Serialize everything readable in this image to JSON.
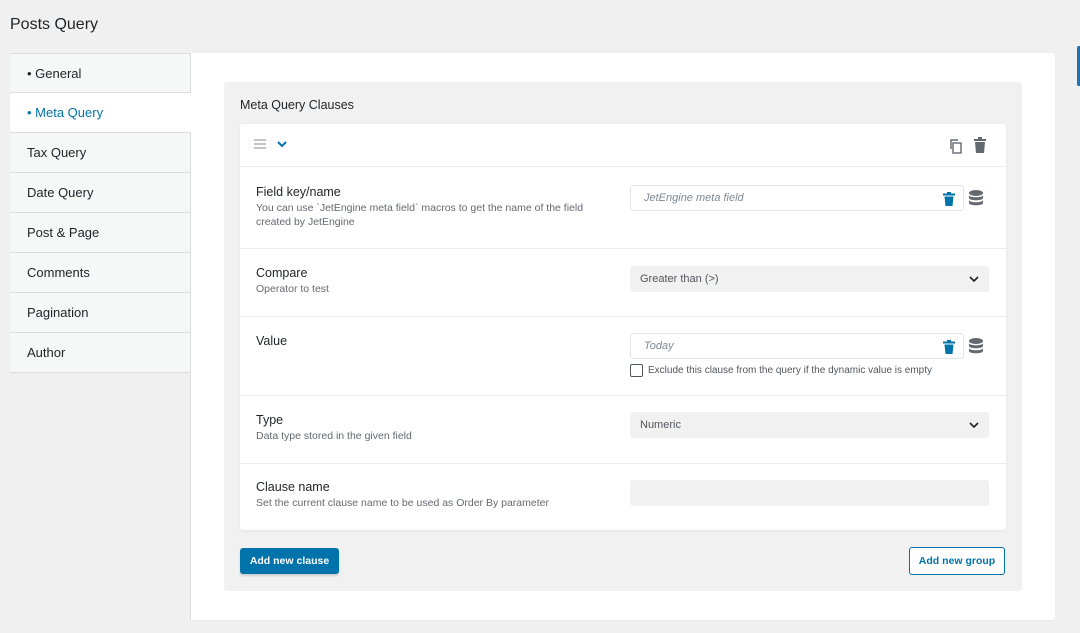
{
  "page": {
    "title": "Posts Query"
  },
  "sidebar": {
    "items": [
      {
        "label": "• General",
        "active": false
      },
      {
        "label": "• Meta Query",
        "active": true
      },
      {
        "label": "Tax Query",
        "active": false
      },
      {
        "label": "Date Query",
        "active": false
      },
      {
        "label": "Post & Page",
        "active": false
      },
      {
        "label": "Comments",
        "active": false
      },
      {
        "label": "Pagination",
        "active": false
      },
      {
        "label": "Author",
        "active": false
      }
    ]
  },
  "meta_query": {
    "section_title": "Meta Query Clauses",
    "clause": {
      "field_key": {
        "label": "Field key/name",
        "description": "You can use `JetEngine meta field` macros to get the name of the field created by JetEngine",
        "value": "JetEngine meta field"
      },
      "compare": {
        "label": "Compare",
        "description": "Operator to test",
        "selected": "Greater than (>)"
      },
      "value": {
        "label": "Value",
        "value": "Today",
        "exclude_checkbox_label": "Exclude this clause from the query if the dynamic value is empty",
        "exclude_checked": false
      },
      "type": {
        "label": "Type",
        "description": "Data type stored in the given field",
        "selected": "Numeric"
      },
      "clause_name": {
        "label": "Clause name",
        "description": "Set the current clause name to be used as Order By parameter",
        "value": ""
      }
    },
    "add_clause_label": "Add new clause",
    "add_group_label": "Add new group"
  },
  "colors": {
    "accent": "#0073aa",
    "background": "#f0f0f1",
    "panel": "#ffffff"
  },
  "icons": {
    "drag": "drag-handle-icon",
    "toggle": "chevron-down-icon",
    "copy": "copy-icon",
    "delete": "trash-icon",
    "dynamic": "database-icon"
  }
}
